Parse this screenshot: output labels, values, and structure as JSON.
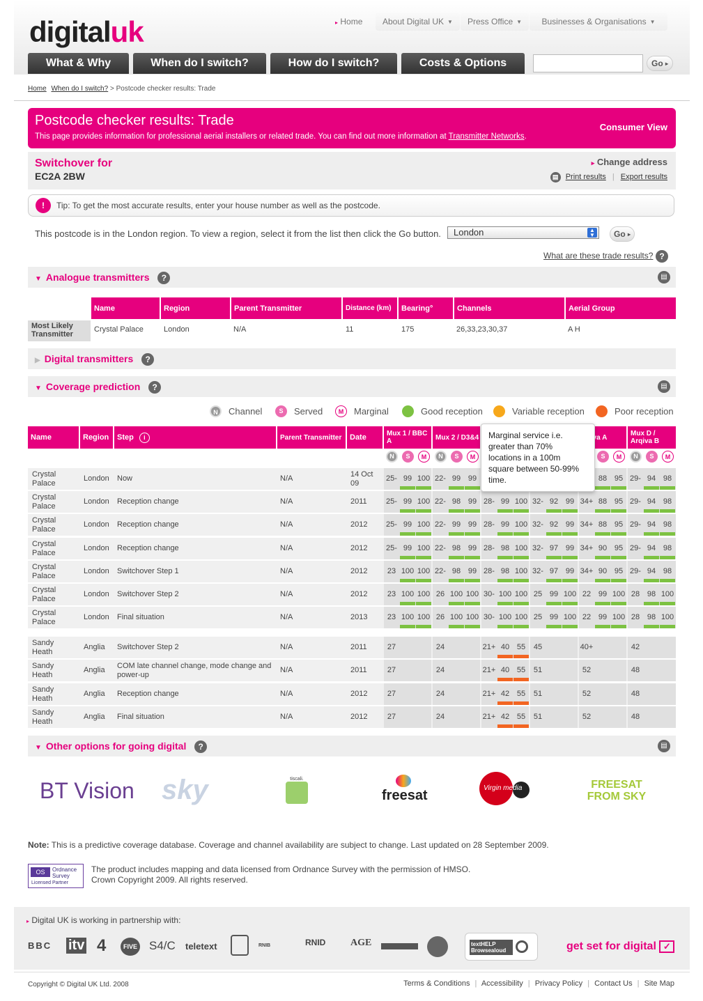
{
  "brand": {
    "logo_main": "digital",
    "logo_accent": "uk"
  },
  "topnav": {
    "home": "Home",
    "about": "About Digital UK",
    "press": "Press Office",
    "business": "Businesses & Organisations"
  },
  "mainnav": [
    "What & Why",
    "When do I switch?",
    "How do I switch?",
    "Costs & Options"
  ],
  "search": {
    "go": "Go"
  },
  "breadcrumb": {
    "home": "Home",
    "when": "When do I switch?",
    "current": "Postcode checker results: Trade",
    "sep": ">"
  },
  "banner": {
    "title": "Postcode checker results: Trade",
    "text": "This page provides information for professional aerial installers or related trade. You can find out more information at",
    "link": "Transmitter Networks",
    "period": ".",
    "consumer": "Consumer View"
  },
  "switchover": {
    "label": "Switchover for",
    "postcode": "EC2A 2BW",
    "change": "Change address",
    "print": "Print results",
    "export": "Export results"
  },
  "tip": {
    "text": "Tip: To get the most accurate results, enter your house number as well as the postcode."
  },
  "region": {
    "text": "This postcode is in the London region. To view a region, select it from the list then click the Go button.",
    "selected": "London",
    "go": "Go"
  },
  "what_link": "What are these trade results?",
  "analogue": {
    "title": "Analogue transmitters",
    "headers": [
      "Name",
      "Region",
      "Parent Transmitter",
      "Distance (km)",
      "Bearing°",
      "Channels",
      "Aerial Group"
    ],
    "row_label": "Most Likely Transmitter",
    "row": [
      "Crystal Palace",
      "London",
      "N/A",
      "11",
      "175",
      "26,33,23,30,37",
      "A H"
    ]
  },
  "digital": {
    "title": "Digital transmitters"
  },
  "coverage": {
    "title": "Coverage prediction",
    "legend": [
      "Channel",
      "Served",
      "Marginal",
      "Good reception",
      "Variable reception",
      "Poor reception"
    ],
    "headers": [
      "Name",
      "Region",
      "Step",
      "Parent Transmitter",
      "Date",
      "Mux 1 / BBC A",
      "Mux 2 / D3&4",
      "C / va A",
      "Mux D / Arqiva B"
    ],
    "tooltip": "Marginal service i.e. greater than 70% locations in a 100m square between 50-99% time.",
    "rows": [
      {
        "name": "Crystal Palace",
        "region": "London",
        "step": "Now",
        "parent": "N/A",
        "date": "14 Oct 09",
        "vals": [
          "25-",
          "99",
          "100",
          "22-",
          "99",
          "99",
          "",
          "",
          "",
          "",
          "",
          "",
          "",
          "88",
          "95",
          "29-",
          "94",
          "98"
        ]
      },
      {
        "name": "Crystal Palace",
        "region": "London",
        "step": "Reception change",
        "parent": "N/A",
        "date": "2011",
        "vals": [
          "25-",
          "99",
          "100",
          "22-",
          "98",
          "99",
          "28-",
          "99",
          "100",
          "32-",
          "92",
          "99",
          "34+",
          "88",
          "95",
          "29-",
          "94",
          "98"
        ]
      },
      {
        "name": "Crystal Palace",
        "region": "London",
        "step": "Reception change",
        "parent": "N/A",
        "date": "2012",
        "vals": [
          "25-",
          "99",
          "100",
          "22-",
          "99",
          "99",
          "28-",
          "99",
          "100",
          "32-",
          "92",
          "99",
          "34+",
          "88",
          "95",
          "29-",
          "94",
          "98"
        ]
      },
      {
        "name": "Crystal Palace",
        "region": "London",
        "step": "Reception change",
        "parent": "N/A",
        "date": "2012",
        "vals": [
          "25-",
          "99",
          "100",
          "22-",
          "98",
          "99",
          "28-",
          "98",
          "100",
          "32-",
          "97",
          "99",
          "34+",
          "90",
          "95",
          "29-",
          "94",
          "98"
        ]
      },
      {
        "name": "Crystal Palace",
        "region": "London",
        "step": "Switchover Step 1",
        "parent": "N/A",
        "date": "2012",
        "vals": [
          "23",
          "100",
          "100",
          "22-",
          "98",
          "99",
          "28-",
          "98",
          "100",
          "32-",
          "97",
          "99",
          "34+",
          "90",
          "95",
          "29-",
          "94",
          "98"
        ]
      },
      {
        "name": "Crystal Palace",
        "region": "London",
        "step": "Switchover Step 2",
        "parent": "N/A",
        "date": "2012",
        "vals": [
          "23",
          "100",
          "100",
          "26",
          "100",
          "100",
          "30-",
          "100",
          "100",
          "25",
          "99",
          "100",
          "22",
          "99",
          "100",
          "28",
          "98",
          "100"
        ]
      },
      {
        "name": "Crystal Palace",
        "region": "London",
        "step": "Final situation",
        "parent": "N/A",
        "date": "2013",
        "vals": [
          "23",
          "100",
          "100",
          "26",
          "100",
          "100",
          "30-",
          "100",
          "100",
          "25",
          "99",
          "100",
          "22",
          "99",
          "100",
          "28",
          "98",
          "100"
        ]
      },
      {
        "name": "Sandy Heath",
        "region": "Anglia",
        "step": "Switchover Step 2",
        "parent": "N/A",
        "date": "2011",
        "vals": [
          "27",
          "",
          "",
          "24",
          "",
          "",
          "21+",
          "40",
          "55",
          "45",
          "",
          "",
          "40+",
          "",
          "",
          "42",
          "",
          ""
        ]
      },
      {
        "name": "Sandy Heath",
        "region": "Anglia",
        "step": "COM late channel change, mode change and power-up",
        "parent": "N/A",
        "date": "2011",
        "vals": [
          "27",
          "",
          "",
          "24",
          "",
          "",
          "21+",
          "40",
          "55",
          "51",
          "",
          "",
          "52",
          "",
          "",
          "48",
          "",
          ""
        ]
      },
      {
        "name": "Sandy Heath",
        "region": "Anglia",
        "step": "Reception change",
        "parent": "N/A",
        "date": "2012",
        "vals": [
          "27",
          "",
          "",
          "24",
          "",
          "",
          "21+",
          "42",
          "55",
          "51",
          "",
          "",
          "52",
          "",
          "",
          "48",
          "",
          ""
        ]
      },
      {
        "name": "Sandy Heath",
        "region": "Anglia",
        "step": "Final situation",
        "parent": "N/A",
        "date": "2012",
        "vals": [
          "27",
          "",
          "",
          "24",
          "",
          "",
          "21+",
          "42",
          "55",
          "51",
          "",
          "",
          "52",
          "",
          "",
          "48",
          "",
          ""
        ]
      }
    ]
  },
  "other": {
    "title": "Other options for going digital",
    "logos": [
      "BT Vision",
      "sky",
      "tiscali.",
      "freesat",
      "Virgin media",
      "FREESAT FROM SKY"
    ]
  },
  "note": {
    "label": "Note:",
    "text": "This is a predictive coverage database. Coverage and channel availability are subject to change. Last updated on 28 September 2009."
  },
  "os": {
    "badge1": "Ordnance",
    "badge2": "Survey",
    "badge3": "Licensed Partner",
    "line1": "The product includes mapping and data licensed from Ordnance Survey with the permission of HMSO.",
    "line2": "Crown Copyright 2009. All rights reserved."
  },
  "partners": {
    "title": "Digital UK is working in partnership with:",
    "logos": [
      "BBC",
      "itv",
      "4",
      "FIVE",
      "S4/C",
      "teletext",
      "RNID",
      "AGE",
      "textHELP Browsealoud"
    ],
    "getset": "get set for digital"
  },
  "footer": {
    "copyright": "Copyright © Digital UK Ltd. 2008",
    "links": [
      "Terms & Conditions",
      "Accessibility",
      "Privacy Policy",
      "Contact Us",
      "Site Map"
    ]
  },
  "colors": {
    "accent": "#e6007e",
    "good": "#7dc242",
    "variable": "#f7a81b",
    "poor": "#f26522"
  }
}
